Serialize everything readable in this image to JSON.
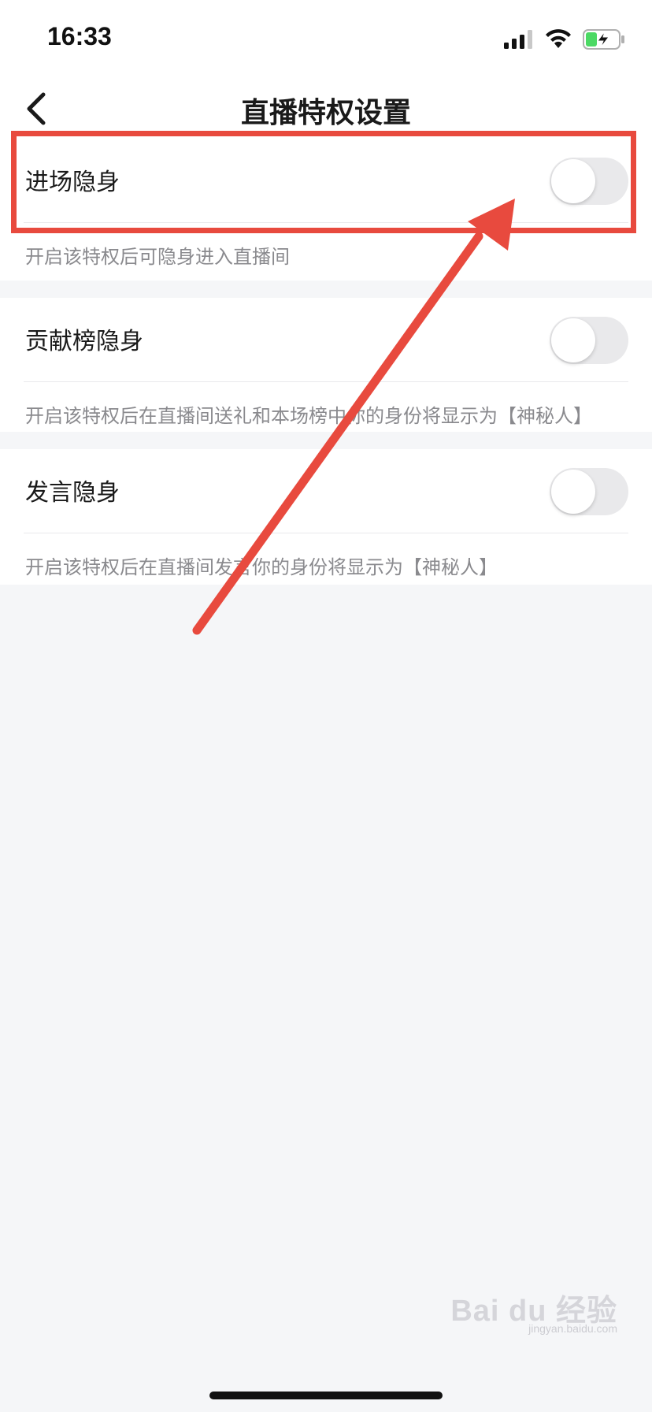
{
  "status_bar": {
    "time": "16:33",
    "signal_icon": "cellular-signal-icon",
    "wifi_icon": "wifi-icon",
    "battery_icon": "battery-charging-icon",
    "battery_color": "#4cd964"
  },
  "nav": {
    "title": "直播特权设置",
    "back_icon": "chevron-left-icon"
  },
  "settings": [
    {
      "label": "进场隐身",
      "description": "开启该特权后可隐身进入直播间",
      "enabled": false
    },
    {
      "label": "贡献榜隐身",
      "description": "开启该特权后在直播间送礼和本场榜中你的身份将显示为【神秘人】",
      "enabled": false
    },
    {
      "label": "发言隐身",
      "description": "开启该特权后在直播间发言你的身份将显示为【神秘人】",
      "enabled": false
    }
  ],
  "annotation": {
    "color": "#e84a3e"
  },
  "watermark": {
    "text": "Bai du 经验",
    "sub": "jingyan.baidu.com"
  }
}
